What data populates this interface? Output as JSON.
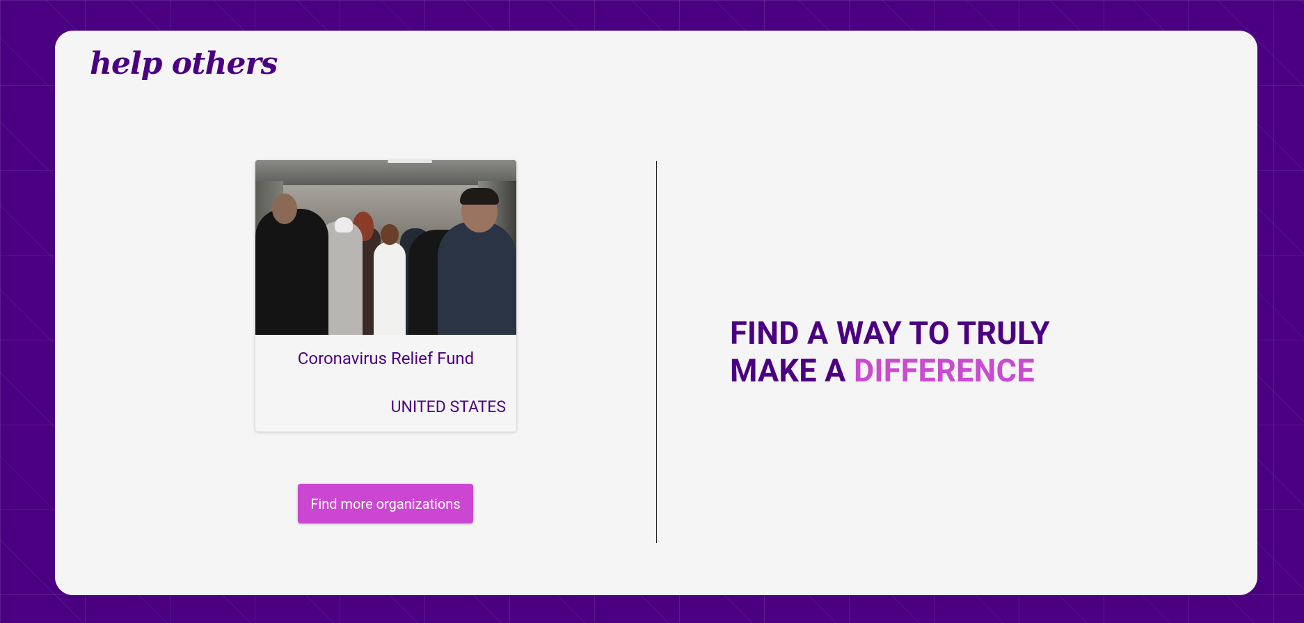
{
  "site": {
    "logo_text": "help others"
  },
  "featured_card": {
    "image_alt": "People wearing face masks in an airport arrivals hall",
    "title": "Coronavirus Relief Fund",
    "country": "UNITED STATES"
  },
  "actions": {
    "find_more_label": "Find more organizations"
  },
  "hero": {
    "line1": "FIND A WAY TO TRULY",
    "line2_plain": "MAKE A ",
    "line2_accent": "DIFFERENCE"
  },
  "colors": {
    "brand_purple": "#4b0081",
    "accent_magenta": "#cb47d1",
    "panel_background": "#f5f5f5"
  }
}
